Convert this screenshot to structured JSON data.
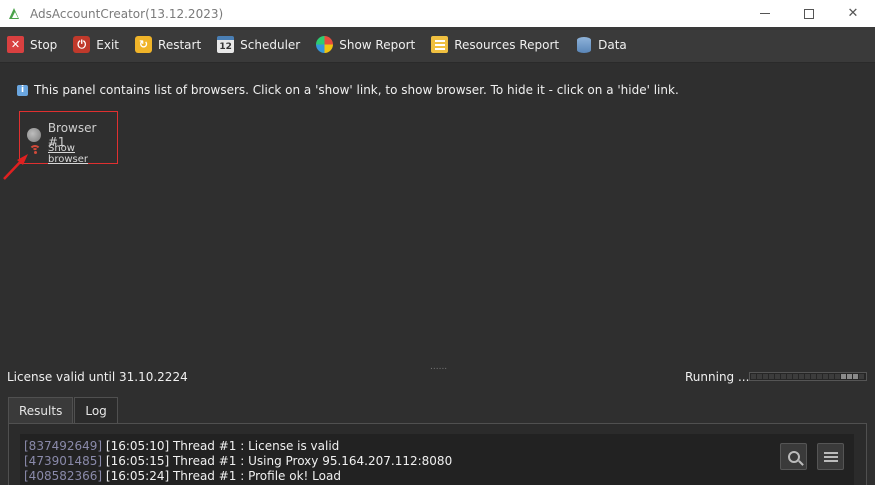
{
  "window": {
    "title": "AdsAccountCreator(13.12.2023)",
    "min_glyph": "",
    "max_glyph": "",
    "close_glyph": "✕"
  },
  "toolbar": {
    "buttons": [
      {
        "label": "Stop",
        "icon": "stop-icon"
      },
      {
        "label": "Exit",
        "icon": "power-icon"
      },
      {
        "label": "Restart",
        "icon": "restart-icon"
      },
      {
        "label": "Scheduler",
        "icon": "calendar-icon",
        "glyph": "12"
      },
      {
        "label": "Show Report",
        "icon": "pie-chart-icon"
      },
      {
        "label": "Resources Report",
        "icon": "list-icon"
      },
      {
        "label": "Data",
        "icon": "database-icon"
      }
    ]
  },
  "panel": {
    "info_text": "This panel contains list of browsers. Click on a 'show' link, to show browser. To hide it - click on a 'hide' link.",
    "browsers": [
      {
        "title": "Browser #1",
        "link": "Show browser"
      }
    ],
    "splitter": "......"
  },
  "status": {
    "license": "License valid until 31.10.2224",
    "state": "Running ...",
    "progress_segments_on": [
      15,
      16,
      17
    ]
  },
  "tabs": [
    {
      "label": "Results",
      "active": false
    },
    {
      "label": "Log",
      "active": true
    }
  ],
  "log": {
    "lines": [
      {
        "id": "[837492649]",
        "text": " [16:05:10] Thread #1 : License is valid"
      },
      {
        "id": "[473901485]",
        "text": " [16:05:15] Thread #1 : Using Proxy 95.164.207.112:8080"
      },
      {
        "id": "[408582366]",
        "text": " [16:05:24] Thread #1 : Profile ok! Load"
      }
    ]
  },
  "colors": {
    "accent_red": "#e03030",
    "background": "#2f2f2f",
    "toolbar": "#3a3a3a"
  }
}
